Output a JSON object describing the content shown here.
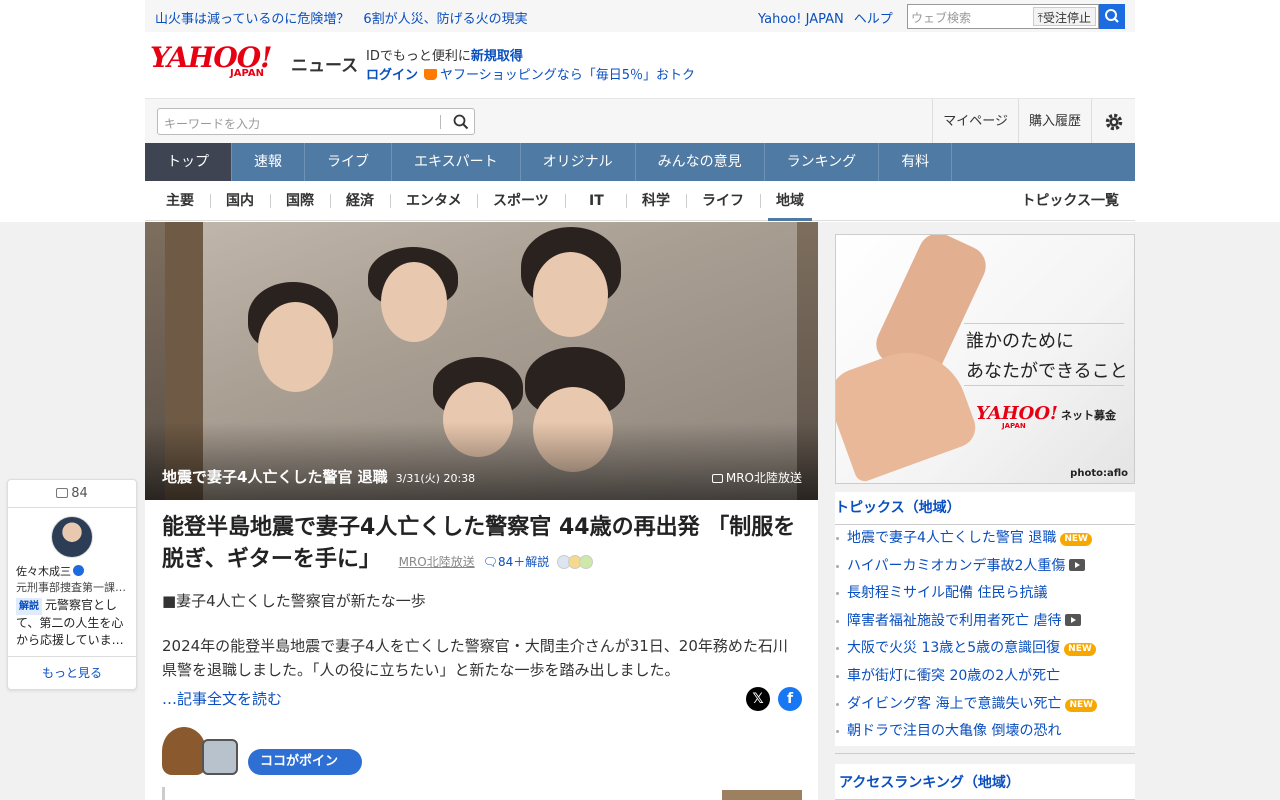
{
  "utilbar": {
    "promo": [
      "山火事は減っているのに危険増？",
      "6割が人災、防げる火の現実"
    ],
    "yahoo_japan": "Yahoo! JAPAN",
    "help": "ヘルプ",
    "web_search_placeholder": "ウェブ検索",
    "stop_label": "受注停止"
  },
  "header": {
    "logo_text": "YAHOO!",
    "logo_sub": "JAPAN",
    "section_name": "ニュース",
    "id_prompt": "IDでもっと便利に",
    "signup": "新規取得",
    "login": "ログイン",
    "shopping_promo": "ヤフーショッピングなら「毎日5％」おトク"
  },
  "search": {
    "placeholder": "キーワードを入力",
    "mypage": "マイページ",
    "history": "購入履歴"
  },
  "mainnav": [
    "トップ",
    "速報",
    "ライブ",
    "エキスパート",
    "オリジナル",
    "みんなの意見",
    "ランキング",
    "有料"
  ],
  "subnav": {
    "items": [
      "主要",
      "国内",
      "国際",
      "経済",
      "エンタメ",
      "スポーツ",
      "IT",
      "科学",
      "ライフ",
      "地域"
    ],
    "all_topics": "トピックス一覧"
  },
  "article": {
    "photo_caption": "地震で妻子4人亡くした警官 退職",
    "photo_datetime": "3/31(火) 20:38",
    "photo_credit": "MRO北陸放送",
    "headline": "能登半島地震で妻子4人亡くした警察官 44歳の再出発 「制服を脱ぎ、ギターを手に」",
    "source": "MRO北陸放送",
    "comment_count": "84＋解説",
    "lead": "■妻子4人亡くした警察官が新たな一歩",
    "body": "2024年の能登半島地震で妻子4人を亡くした警察官・大間圭介さんが31日、20年務めた石川県警を退職しました。「人の役に立ちたい」と新たな一歩を踏み出しました。",
    "read_more": "…記事全文を読む",
    "point_label": "ココがポイント"
  },
  "comment_card": {
    "count": "84",
    "author": "佐々木成三",
    "author_title": "元刑事部捜査第一課…",
    "badge": "解説",
    "comment": "元警察官として、第二の人生を心から応援していま…",
    "more": "もっと見る"
  },
  "ad": {
    "line1": "誰かのために",
    "line2": "あなたができること",
    "logo": "YAHOO!",
    "logo_sub": "JAPAN",
    "service": "ネット募金",
    "photo_credit": "photo:aflo"
  },
  "topics": {
    "heading": "トピックス（地域）",
    "items": [
      {
        "text": "地震で妻子4人亡くした警官 退職",
        "badge": "NEW"
      },
      {
        "text": "ハイパーカミオカンデ事故2人重傷",
        "video": true
      },
      {
        "text": "長射程ミサイル配備 住民ら抗議"
      },
      {
        "text": "障害者福祉施設で利用者死亡 虐待",
        "video": true
      },
      {
        "text": "大阪で火災 13歳と5歳の意識回復",
        "badge": "NEW"
      },
      {
        "text": "車が街灯に衝突 20歳の2人が死亡"
      },
      {
        "text": "ダイビング客 海上で意識失い死亡",
        "badge": "NEW"
      },
      {
        "text": "朝ドラで注目の大亀像 倒壊の恐れ"
      }
    ]
  },
  "ranking": {
    "heading": "アクセスランキング（地域）"
  },
  "colors": {
    "brand_red": "#e60012",
    "link_blue": "#0a4fbf",
    "nav_blue": "#4f7aa3",
    "nav_active": "#3e4452",
    "new_badge": "#f6a800"
  }
}
